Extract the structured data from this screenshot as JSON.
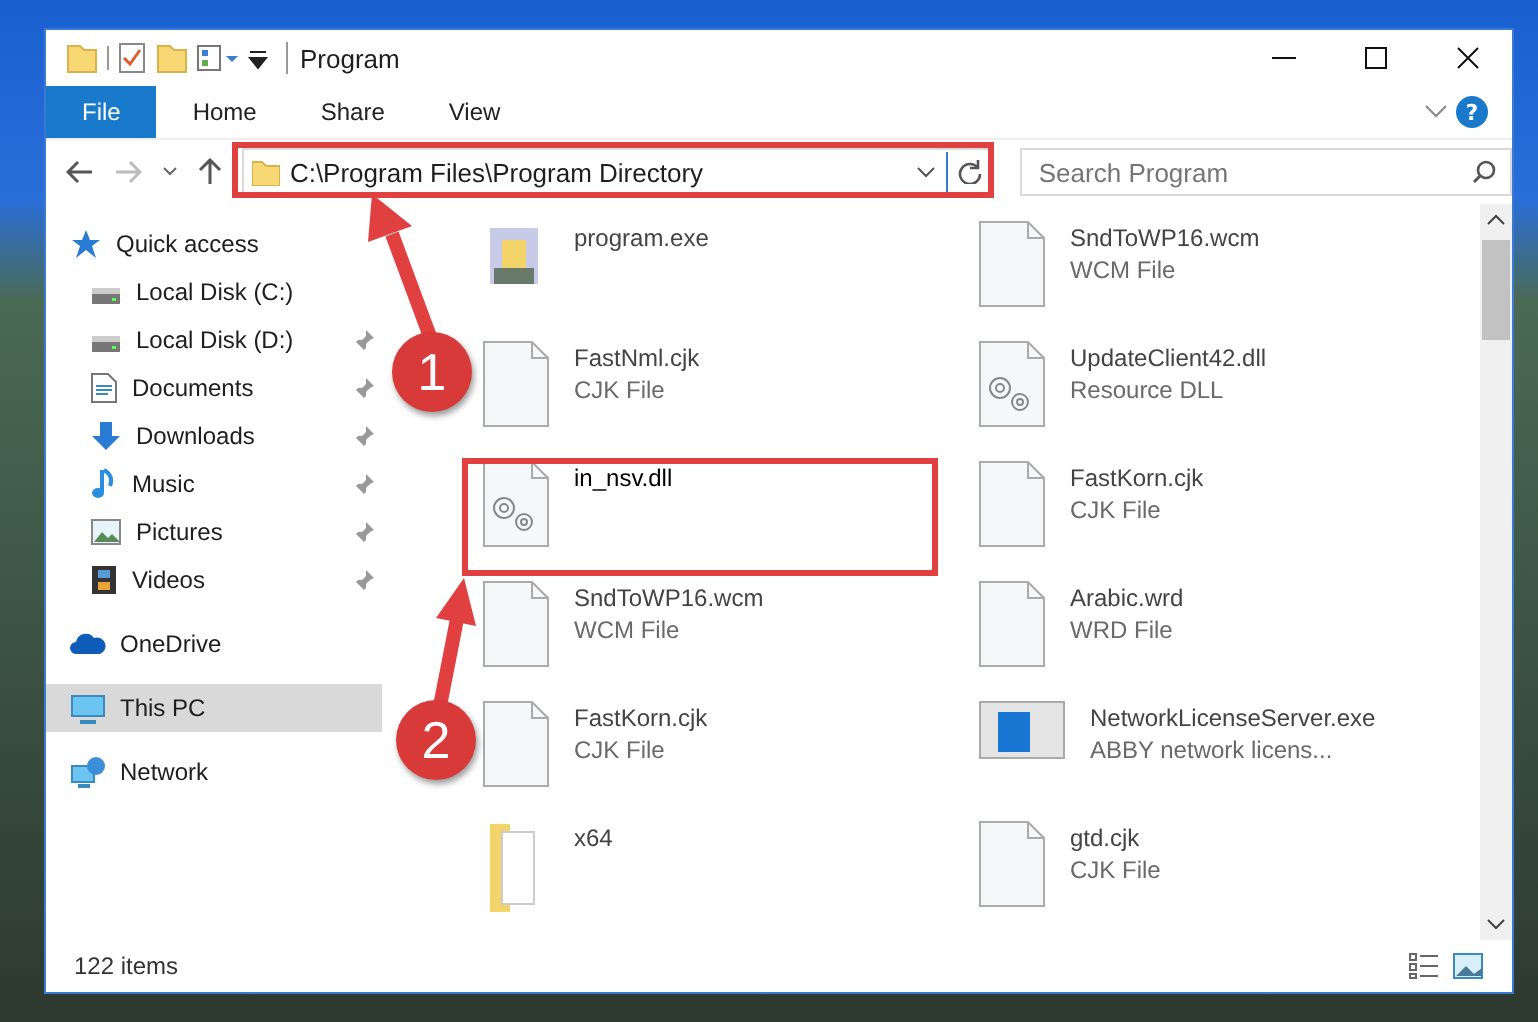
{
  "window": {
    "title": "Program"
  },
  "ribbon_tabs": [
    {
      "label": "File",
      "selected": true
    },
    {
      "label": "Home",
      "selected": false
    },
    {
      "label": "Share",
      "selected": false
    },
    {
      "label": "View",
      "selected": false
    }
  ],
  "help": "?",
  "address": {
    "path": "C:\\Program Files\\Program Directory"
  },
  "search": {
    "placeholder": "Search Program"
  },
  "sidebar": {
    "items": [
      {
        "label": "Quick access",
        "kind": "star",
        "selected": false,
        "children": [
          {
            "label": "Local Disk (C:)",
            "kind": "disk",
            "pinned": false
          },
          {
            "label": "Local Disk (D:)",
            "kind": "disk",
            "pinned": true
          },
          {
            "label": "Documents",
            "kind": "doc",
            "pinned": true
          },
          {
            "label": "Downloads",
            "kind": "download",
            "pinned": true
          },
          {
            "label": "Music",
            "kind": "music",
            "pinned": true
          },
          {
            "label": "Pictures",
            "kind": "picture",
            "pinned": true
          },
          {
            "label": "Videos",
            "kind": "video",
            "pinned": true
          }
        ]
      },
      {
        "label": "OneDrive",
        "kind": "cloud",
        "selected": false
      },
      {
        "label": "This PC",
        "kind": "pc",
        "selected": true
      },
      {
        "label": "Network",
        "kind": "network",
        "selected": false
      }
    ]
  },
  "files": [
    {
      "name": "program.exe",
      "kind": "exe",
      "dimmed": true
    },
    {
      "name": "SndToWP16.wcm",
      "type": "WCM File",
      "kind": "blank",
      "dimmed": true
    },
    {
      "name": "FastNml.cjk",
      "type": "CJK File",
      "kind": "blank",
      "dimmed": true
    },
    {
      "name": "UpdateClient42.dll",
      "type": "Resource DLL",
      "kind": "dll",
      "dimmed": true
    },
    {
      "name": "in_nsv.dll",
      "kind": "dll",
      "dimmed": false
    },
    {
      "name": "FastKorn.cjk",
      "type": "CJK File",
      "kind": "blank",
      "dimmed": true
    },
    {
      "name": "SndToWP16.wcm",
      "type": "WCM File",
      "kind": "blank",
      "dimmed": true
    },
    {
      "name": "Arabic.wrd",
      "type": "WRD File",
      "kind": "blank",
      "dimmed": true
    },
    {
      "name": "FastKorn.cjk",
      "type": "CJK File",
      "kind": "blank",
      "dimmed": true
    },
    {
      "name": "NetworkLicenseServer.exe",
      "type": "ABBY network licens...",
      "kind": "app",
      "dimmed": true
    },
    {
      "name": "x64",
      "kind": "folder",
      "dimmed": true
    },
    {
      "name": "gtd.cjk",
      "type": "CJK File",
      "kind": "blank",
      "dimmed": true
    }
  ],
  "status_bar": {
    "count": "122 items"
  },
  "callouts": [
    {
      "label": "1"
    },
    {
      "label": "2"
    }
  ]
}
